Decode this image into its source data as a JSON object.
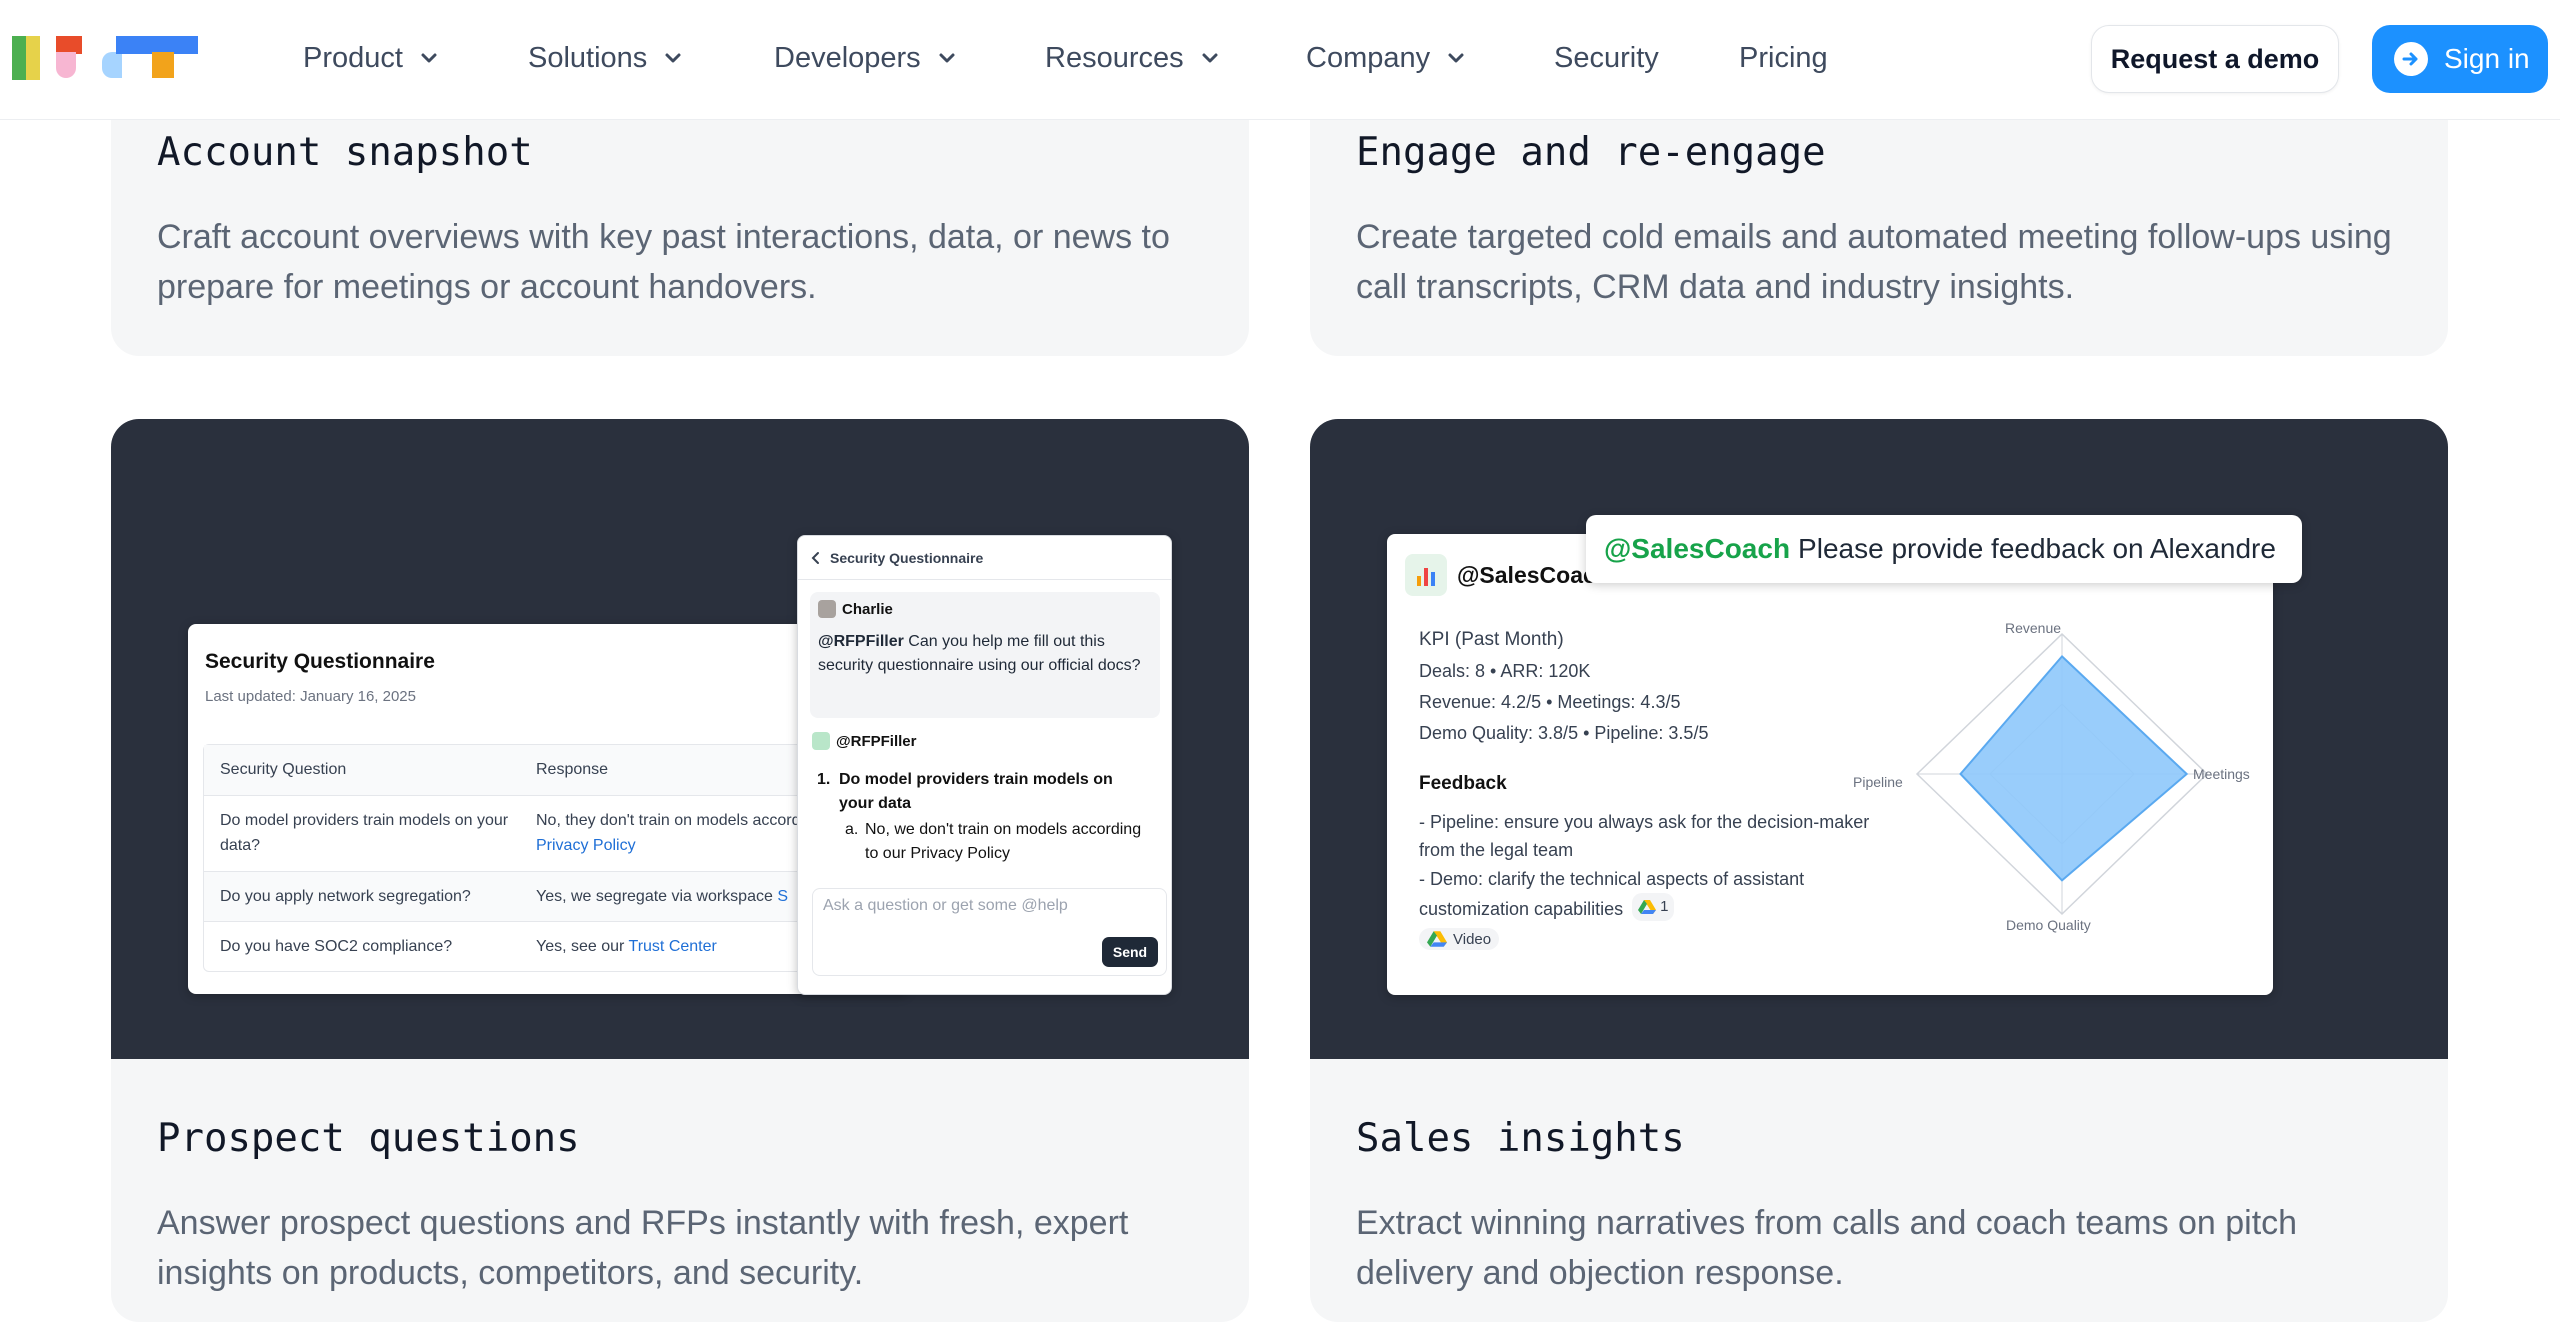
{
  "nav": {
    "items": [
      {
        "label": "Product",
        "dropdown": true
      },
      {
        "label": "Solutions",
        "dropdown": true
      },
      {
        "label": "Developers",
        "dropdown": true
      },
      {
        "label": "Resources",
        "dropdown": true
      },
      {
        "label": "Company",
        "dropdown": true
      },
      {
        "label": "Security",
        "dropdown": false
      },
      {
        "label": "Pricing",
        "dropdown": false
      }
    ],
    "request_demo": "Request a demo",
    "sign_in": "Sign in"
  },
  "cards": {
    "account_snapshot": {
      "title": "Account snapshot",
      "description": "Craft account overviews with key past interactions, data, or news to prepare for meetings or account handovers."
    },
    "engage": {
      "title": "Engage and re-engage",
      "description": "Create targeted cold emails and automated meeting follow-ups using call transcripts, CRM data and industry insights."
    },
    "prospect": {
      "title": "Prospect questions",
      "description": "Answer prospect questions and RFPs instantly with fresh, expert insights on products, competitors, and security."
    },
    "sales": {
      "title": "Sales insights",
      "description": "Extract winning narratives from calls and coach teams on pitch delivery and objection response."
    }
  },
  "security_doc": {
    "title": "Security Questionnaire",
    "updated": "Last updated: January 16, 2025",
    "headers": [
      "Security Question",
      "Response"
    ],
    "rows": [
      {
        "q": "Do model providers train models on your data?",
        "a": "No, they don't train on models according to our",
        "link": "Privacy Policy"
      },
      {
        "q": "Do you apply network segregation?",
        "a": "Yes, we segregate via workspace",
        "link": "S"
      },
      {
        "q": "Do you have SOC2 compliance?",
        "a": "Yes, see our",
        "link": "Trust Center"
      }
    ]
  },
  "chat": {
    "header": "Security Questionnaire",
    "user": "Charlie",
    "mention": "@RFPFiller",
    "question": "Can you help me fill out this security questionnaire using our official docs?",
    "bot": "@RFPFiller",
    "answer_1": "Do model providers train models on your data",
    "answer_1a": "No, we don't train on models according to our Privacy Policy",
    "input_placeholder": "Ask a question or get some @help",
    "send": "Send"
  },
  "sales_panel": {
    "agent": "@SalesCoach",
    "prompt_mention": "@SalesCoach",
    "prompt_text": "Please provide feedback on Alexandre",
    "kpi_title": "KPI (Past Month)",
    "kpi_lines": [
      "Deals: 8 • ARR: 120K",
      "Revenue: 4.2/5 • Meetings: 4.3/5",
      "Demo Quality: 3.8/5 • Pipeline: 3.5/5"
    ],
    "feedback_title": "Feedback",
    "feedback_1": "- Pipeline: ensure you always ask for the decision-maker from the legal team",
    "feedback_2": "- Demo: clarify the technical aspects of assistant customization capabilities",
    "drive_count": "1",
    "video_label": "Video",
    "radar": {
      "axes": [
        "Revenue",
        "Meetings",
        "Demo Quality",
        "Pipeline"
      ],
      "values": [
        4.2,
        4.3,
        3.8,
        3.5
      ],
      "max": 5,
      "fill": "#8ec8fb",
      "stroke": "#5aa9f0"
    }
  },
  "colors": {
    "accent": "#1c91ff",
    "dark_bg": "#2a303d",
    "card_bg": "#f5f6f7",
    "mention_green": "#17a34a"
  }
}
